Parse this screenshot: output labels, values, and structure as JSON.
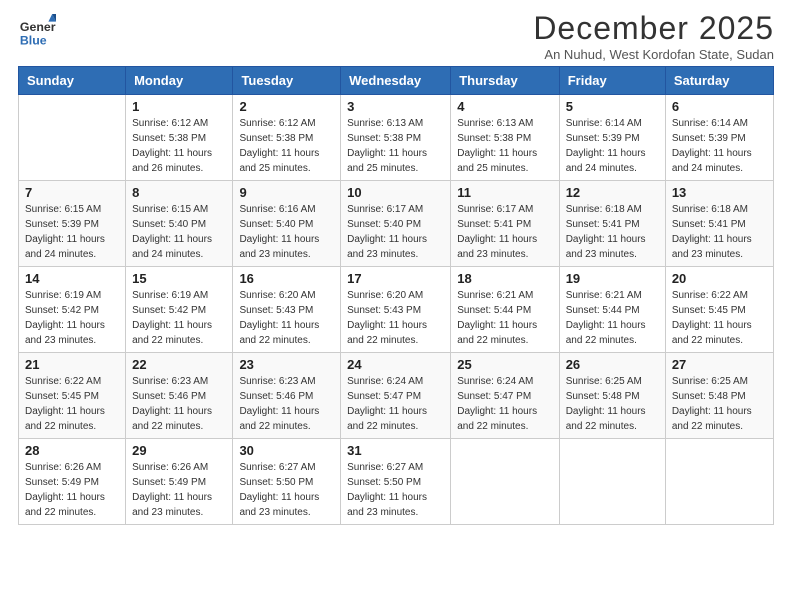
{
  "logo": {
    "general": "General",
    "blue": "Blue"
  },
  "title": "December 2025",
  "subtitle": "An Nuhud, West Kordofan State, Sudan",
  "headers": [
    "Sunday",
    "Monday",
    "Tuesday",
    "Wednesday",
    "Thursday",
    "Friday",
    "Saturday"
  ],
  "weeks": [
    [
      {
        "day": "",
        "sunrise": "",
        "sunset": "",
        "daylight": ""
      },
      {
        "day": "1",
        "sunrise": "Sunrise: 6:12 AM",
        "sunset": "Sunset: 5:38 PM",
        "daylight": "Daylight: 11 hours and 26 minutes."
      },
      {
        "day": "2",
        "sunrise": "Sunrise: 6:12 AM",
        "sunset": "Sunset: 5:38 PM",
        "daylight": "Daylight: 11 hours and 25 minutes."
      },
      {
        "day": "3",
        "sunrise": "Sunrise: 6:13 AM",
        "sunset": "Sunset: 5:38 PM",
        "daylight": "Daylight: 11 hours and 25 minutes."
      },
      {
        "day": "4",
        "sunrise": "Sunrise: 6:13 AM",
        "sunset": "Sunset: 5:38 PM",
        "daylight": "Daylight: 11 hours and 25 minutes."
      },
      {
        "day": "5",
        "sunrise": "Sunrise: 6:14 AM",
        "sunset": "Sunset: 5:39 PM",
        "daylight": "Daylight: 11 hours and 24 minutes."
      },
      {
        "day": "6",
        "sunrise": "Sunrise: 6:14 AM",
        "sunset": "Sunset: 5:39 PM",
        "daylight": "Daylight: 11 hours and 24 minutes."
      }
    ],
    [
      {
        "day": "7",
        "sunrise": "Sunrise: 6:15 AM",
        "sunset": "Sunset: 5:39 PM",
        "daylight": "Daylight: 11 hours and 24 minutes."
      },
      {
        "day": "8",
        "sunrise": "Sunrise: 6:15 AM",
        "sunset": "Sunset: 5:40 PM",
        "daylight": "Daylight: 11 hours and 24 minutes."
      },
      {
        "day": "9",
        "sunrise": "Sunrise: 6:16 AM",
        "sunset": "Sunset: 5:40 PM",
        "daylight": "Daylight: 11 hours and 23 minutes."
      },
      {
        "day": "10",
        "sunrise": "Sunrise: 6:17 AM",
        "sunset": "Sunset: 5:40 PM",
        "daylight": "Daylight: 11 hours and 23 minutes."
      },
      {
        "day": "11",
        "sunrise": "Sunrise: 6:17 AM",
        "sunset": "Sunset: 5:41 PM",
        "daylight": "Daylight: 11 hours and 23 minutes."
      },
      {
        "day": "12",
        "sunrise": "Sunrise: 6:18 AM",
        "sunset": "Sunset: 5:41 PM",
        "daylight": "Daylight: 11 hours and 23 minutes."
      },
      {
        "day": "13",
        "sunrise": "Sunrise: 6:18 AM",
        "sunset": "Sunset: 5:41 PM",
        "daylight": "Daylight: 11 hours and 23 minutes."
      }
    ],
    [
      {
        "day": "14",
        "sunrise": "Sunrise: 6:19 AM",
        "sunset": "Sunset: 5:42 PM",
        "daylight": "Daylight: 11 hours and 23 minutes."
      },
      {
        "day": "15",
        "sunrise": "Sunrise: 6:19 AM",
        "sunset": "Sunset: 5:42 PM",
        "daylight": "Daylight: 11 hours and 22 minutes."
      },
      {
        "day": "16",
        "sunrise": "Sunrise: 6:20 AM",
        "sunset": "Sunset: 5:43 PM",
        "daylight": "Daylight: 11 hours and 22 minutes."
      },
      {
        "day": "17",
        "sunrise": "Sunrise: 6:20 AM",
        "sunset": "Sunset: 5:43 PM",
        "daylight": "Daylight: 11 hours and 22 minutes."
      },
      {
        "day": "18",
        "sunrise": "Sunrise: 6:21 AM",
        "sunset": "Sunset: 5:44 PM",
        "daylight": "Daylight: 11 hours and 22 minutes."
      },
      {
        "day": "19",
        "sunrise": "Sunrise: 6:21 AM",
        "sunset": "Sunset: 5:44 PM",
        "daylight": "Daylight: 11 hours and 22 minutes."
      },
      {
        "day": "20",
        "sunrise": "Sunrise: 6:22 AM",
        "sunset": "Sunset: 5:45 PM",
        "daylight": "Daylight: 11 hours and 22 minutes."
      }
    ],
    [
      {
        "day": "21",
        "sunrise": "Sunrise: 6:22 AM",
        "sunset": "Sunset: 5:45 PM",
        "daylight": "Daylight: 11 hours and 22 minutes."
      },
      {
        "day": "22",
        "sunrise": "Sunrise: 6:23 AM",
        "sunset": "Sunset: 5:46 PM",
        "daylight": "Daylight: 11 hours and 22 minutes."
      },
      {
        "day": "23",
        "sunrise": "Sunrise: 6:23 AM",
        "sunset": "Sunset: 5:46 PM",
        "daylight": "Daylight: 11 hours and 22 minutes."
      },
      {
        "day": "24",
        "sunrise": "Sunrise: 6:24 AM",
        "sunset": "Sunset: 5:47 PM",
        "daylight": "Daylight: 11 hours and 22 minutes."
      },
      {
        "day": "25",
        "sunrise": "Sunrise: 6:24 AM",
        "sunset": "Sunset: 5:47 PM",
        "daylight": "Daylight: 11 hours and 22 minutes."
      },
      {
        "day": "26",
        "sunrise": "Sunrise: 6:25 AM",
        "sunset": "Sunset: 5:48 PM",
        "daylight": "Daylight: 11 hours and 22 minutes."
      },
      {
        "day": "27",
        "sunrise": "Sunrise: 6:25 AM",
        "sunset": "Sunset: 5:48 PM",
        "daylight": "Daylight: 11 hours and 22 minutes."
      }
    ],
    [
      {
        "day": "28",
        "sunrise": "Sunrise: 6:26 AM",
        "sunset": "Sunset: 5:49 PM",
        "daylight": "Daylight: 11 hours and 22 minutes."
      },
      {
        "day": "29",
        "sunrise": "Sunrise: 6:26 AM",
        "sunset": "Sunset: 5:49 PM",
        "daylight": "Daylight: 11 hours and 23 minutes."
      },
      {
        "day": "30",
        "sunrise": "Sunrise: 6:27 AM",
        "sunset": "Sunset: 5:50 PM",
        "daylight": "Daylight: 11 hours and 23 minutes."
      },
      {
        "day": "31",
        "sunrise": "Sunrise: 6:27 AM",
        "sunset": "Sunset: 5:50 PM",
        "daylight": "Daylight: 11 hours and 23 minutes."
      },
      {
        "day": "",
        "sunrise": "",
        "sunset": "",
        "daylight": ""
      },
      {
        "day": "",
        "sunrise": "",
        "sunset": "",
        "daylight": ""
      },
      {
        "day": "",
        "sunrise": "",
        "sunset": "",
        "daylight": ""
      }
    ]
  ]
}
